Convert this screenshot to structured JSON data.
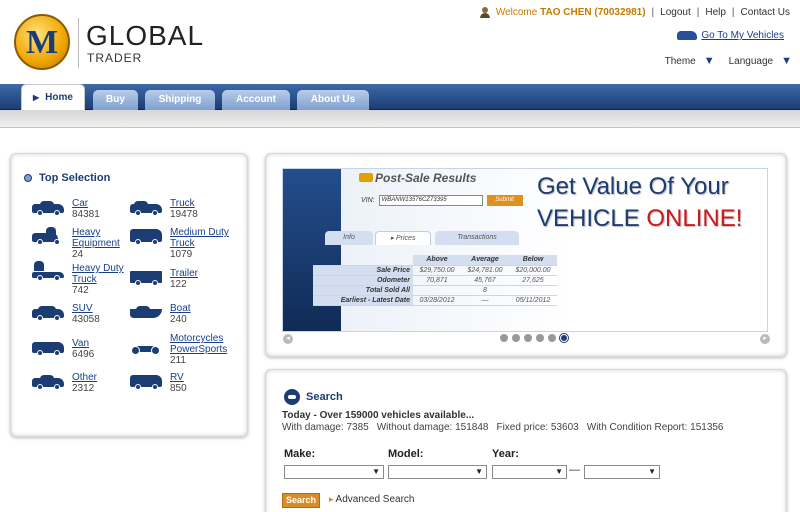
{
  "header": {
    "logo_letter": "M",
    "logo_title": "GLOBAL",
    "logo_subtitle": "TRADER",
    "welcome_prefix": "Welcome",
    "welcome_user": "TAO CHEN (70032981)",
    "logout": "Logout",
    "help": "Help",
    "contact": "Contact Us",
    "my_vehicles": "Go To My Vehicles",
    "theme": "Theme",
    "language": "Language"
  },
  "nav": {
    "tabs": [
      "Home",
      "Buy",
      "Shipping",
      "Account",
      "About Us"
    ]
  },
  "top_selection": {
    "title": "Top Selection",
    "items": [
      {
        "label": "Car",
        "count": "84381",
        "icon": "car-icon"
      },
      {
        "label": "Truck",
        "count": "19478",
        "icon": "pickup-truck-icon"
      },
      {
        "label": "Heavy Equipment",
        "label1": "Heavy",
        "label2": "Equipment",
        "count": "24",
        "icon": "excavator-icon"
      },
      {
        "label": "Medium Duty Truck",
        "label1": "Medium Duty",
        "label2": "Truck",
        "count": "1079",
        "icon": "box-truck-icon"
      },
      {
        "label": "Heavy Duty Truck",
        "label1": "Heavy Duty",
        "label2": "Truck",
        "count": "742",
        "icon": "semi-truck-icon"
      },
      {
        "label": "Trailer",
        "count": "122",
        "icon": "trailer-icon"
      },
      {
        "label": "SUV",
        "count": "43058",
        "icon": "suv-icon"
      },
      {
        "label": "Boat",
        "count": "240",
        "icon": "boat-icon"
      },
      {
        "label": "Van",
        "count": "6496",
        "icon": "van-icon"
      },
      {
        "label": "Motorcycles PowerSports",
        "label1": "Motorcycles",
        "label2": "PowerSports",
        "count": "211",
        "icon": "motorcycle-icon"
      },
      {
        "label": "Other",
        "count": "2312",
        "icon": "other-vehicle-icon"
      },
      {
        "label": "RV",
        "count": "850",
        "icon": "rv-icon"
      }
    ]
  },
  "banner": {
    "title": "Post-Sale Results",
    "vin_label": "VIN:",
    "vin_value": "WBANW13576CZ73395",
    "submit": "Submit",
    "headline1": "Get Value Of Your",
    "headline2_prefix": "VEHICLE",
    "headline2_highlight": "ONLINE!",
    "tabs": [
      "Info",
      "Prices",
      "Transactions"
    ],
    "table": {
      "headers": [
        "Above",
        "Average",
        "Below"
      ],
      "rows": [
        {
          "label": "Sale Price",
          "values": [
            "$29,750.00",
            "$24,781.00",
            "$20,000.00"
          ]
        },
        {
          "label": "Odometer",
          "values": [
            "70,871",
            "45,767",
            "27,625"
          ]
        },
        {
          "label": "Total Sold All",
          "values": [
            "",
            "8",
            ""
          ]
        },
        {
          "label": "Earliest - Latest Date",
          "values": [
            "03/28/2012",
            "—",
            "05/11/2012"
          ]
        }
      ]
    }
  },
  "search": {
    "title": "Search",
    "today_line": "Today - Over 159000 vehicles available...",
    "stats": [
      "With damage: 7385",
      "Without damage: 151848",
      "Fixed price: 53603",
      "With Condition Report: 151356"
    ],
    "make_label": "Make:",
    "model_label": "Model:",
    "year_label": "Year:",
    "year_separator": "—",
    "search_button": "Search",
    "advanced": "Advanced Search"
  }
}
